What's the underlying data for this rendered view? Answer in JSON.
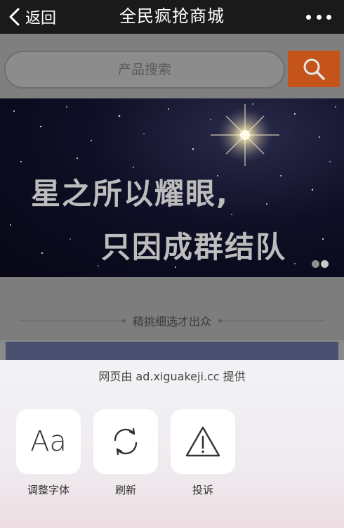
{
  "navbar": {
    "back_label": "返回",
    "title": "全民疯抢商城",
    "more_icon": "more-icon"
  },
  "search": {
    "placeholder": "产品搜索",
    "button_icon": "search-icon",
    "button_color": "#c4541a"
  },
  "banner": {
    "line1": "星之所以耀眼,",
    "line2": "只因成群结队",
    "slides": 2,
    "active_slide": 2
  },
  "section": {
    "title": "精挑细选才出众"
  },
  "sheet": {
    "provider": "网页由 ad.xiguakeji.cc 提供",
    "actions": [
      {
        "label": "调整字体",
        "icon": "font-size-icon",
        "glyph": "Aa"
      },
      {
        "label": "刷新",
        "icon": "refresh-icon"
      },
      {
        "label": "投诉",
        "icon": "warning-icon"
      }
    ]
  }
}
